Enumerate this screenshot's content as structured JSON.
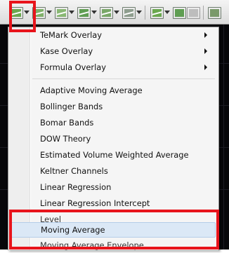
{
  "colors": {
    "highlight_box": "#e8141b",
    "menu_hover": "#dbe8f6",
    "chart_background": "#07070a"
  },
  "toolbar": {
    "buttons": [
      "overlay-chart-icon",
      "indicator-chart-icon",
      "line-study-icon",
      "bar-chart-icon",
      "analysis-icon",
      "study-icon",
      "chart-type-icon",
      "close-chart-icon",
      "window-icon"
    ]
  },
  "menu": {
    "items": [
      {
        "label": "TeMark Overlay",
        "submenu": true
      },
      {
        "label": "Kase Overlay",
        "submenu": true
      },
      {
        "label": "Formula Overlay",
        "submenu": true
      },
      {
        "label": "Adaptive Moving Average"
      },
      {
        "label": "Bollinger Bands"
      },
      {
        "label": "Bomar Bands"
      },
      {
        "label": "DOW Theory"
      },
      {
        "label": "Estimated Volume Weighted Average"
      },
      {
        "label": "Keltner Channels"
      },
      {
        "label": "Linear Regression"
      },
      {
        "label": "Linear Regression Intercept"
      },
      {
        "label": "Level"
      },
      {
        "label": "Moving Average"
      },
      {
        "label": "Moving Average Envelope"
      }
    ]
  }
}
